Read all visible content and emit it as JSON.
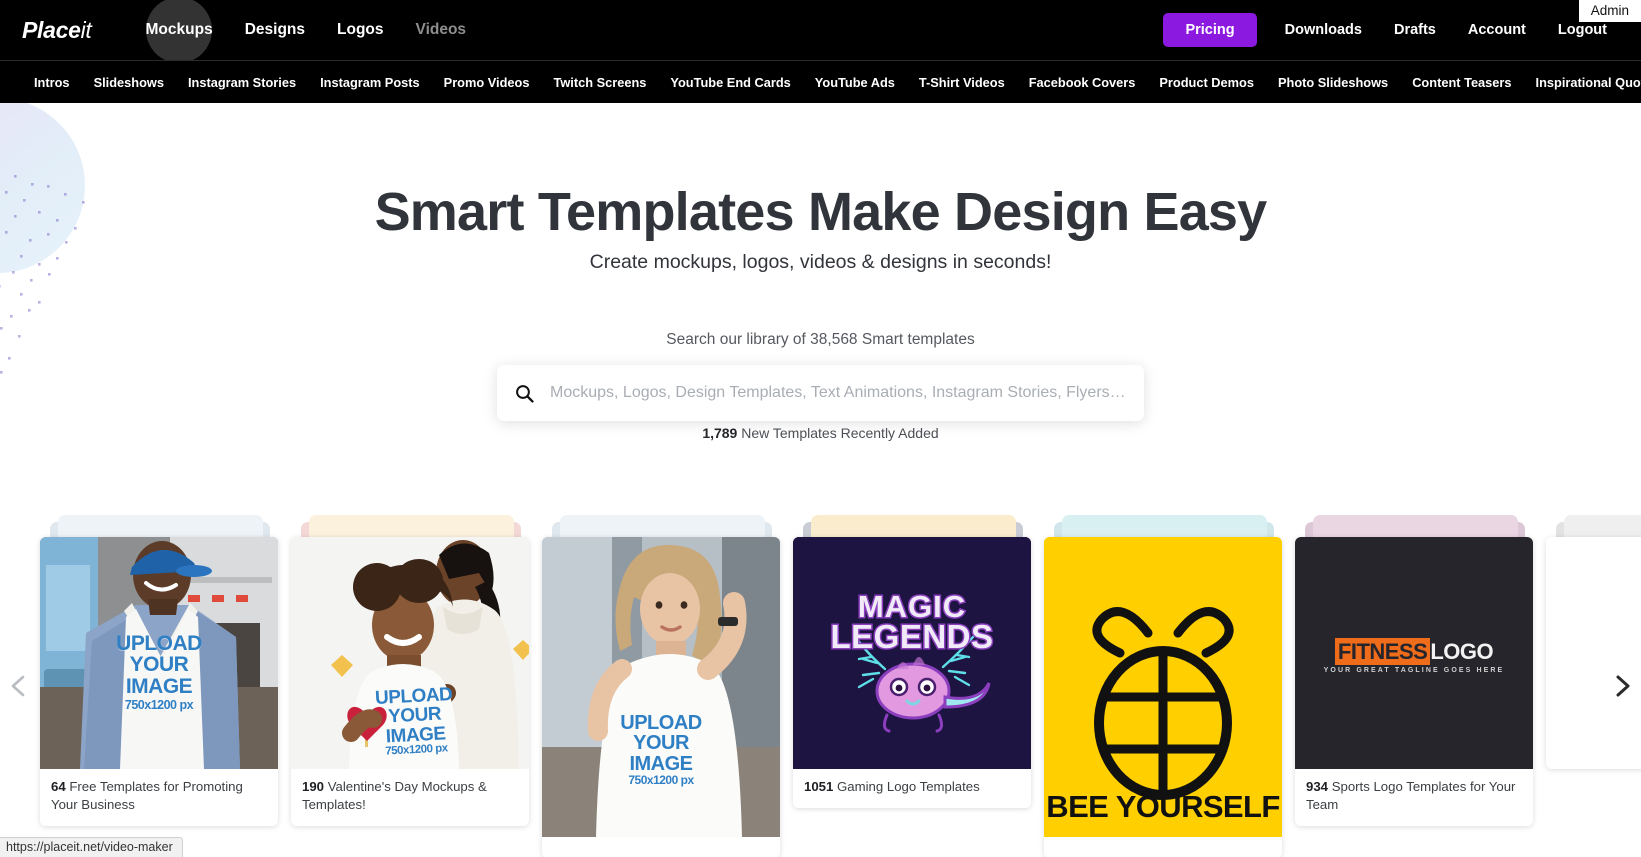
{
  "browser": {
    "status_url": "https://placeit.net/video-maker"
  },
  "header": {
    "logo_main": "Place",
    "logo_accent": "it",
    "admin_badge": "Admin",
    "nav": [
      {
        "label": "Mockups",
        "state": "hover"
      },
      {
        "label": "Designs",
        "state": "normal"
      },
      {
        "label": "Logos",
        "state": "normal"
      },
      {
        "label": "Videos",
        "state": "dim"
      }
    ],
    "pricing_label": "Pricing",
    "account_links": [
      "Downloads",
      "Drafts",
      "Account",
      "Logout"
    ],
    "accent_color": "#8c19e0"
  },
  "subnav": {
    "items": [
      "Intros",
      "Slideshows",
      "Instagram Stories",
      "Instagram Posts",
      "Promo Videos",
      "Twitch Screens",
      "YouTube End Cards",
      "YouTube Ads",
      "T-Shirt Videos",
      "Facebook Covers",
      "Product Demos",
      "Photo Slideshows",
      "Content Teasers",
      "Inspirational Quotes"
    ]
  },
  "hero": {
    "title": "Smart Templates Make Design Easy",
    "subtitle": "Create mockups, logos, videos & designs in seconds!",
    "search_caption": "Search our library of 38,568 Smart templates",
    "search_placeholder": "Mockups, Logos, Design Templates, Text Animations, Instagram Stories, Flyers…",
    "search_value": "",
    "new_templates_count": "1,789",
    "new_templates_text": "New Templates Recently Added"
  },
  "carousel": {
    "prev_icon": "chevron-left-icon",
    "next_icon": "chevron-right-icon",
    "cards": [
      {
        "count": "64",
        "title": "Free Templates for Promoting Your Business",
        "art": "tshirt-man-cap",
        "tee_lines": [
          "UPLOAD",
          "YOUR",
          "IMAGE"
        ],
        "tee_size": "750x1200 px"
      },
      {
        "count": "190",
        "title": "Valentine's Day Mockups & Templates!",
        "art": "tshirt-couple-heart",
        "tee_lines": [
          "UPLOAD",
          "YOUR",
          "IMAGE"
        ],
        "tee_size": "750x1200 px"
      },
      {
        "count": "",
        "title": "",
        "art": "tshirt-woman-street",
        "tee_lines": [
          "UPLOAD",
          "YOUR",
          "IMAGE"
        ],
        "tee_size": "750x1200 px"
      },
      {
        "count": "1051",
        "title": "Gaming Logo Templates",
        "art": "magic-legends-logo",
        "logo_line1": "MAGIC",
        "logo_line2": "LEGENDS"
      },
      {
        "count": "",
        "title": "",
        "art": "bee-yourself-logo",
        "logo_text": "BEE YOURSELF"
      },
      {
        "count": "934",
        "title": "Sports Logo Templates for Your Team",
        "art": "fitness-logo",
        "logo_part1": "FITNESS",
        "logo_part2": "LOGO",
        "logo_tagline": "YOUR GREAT TAGLINE GOES HERE"
      }
    ]
  }
}
